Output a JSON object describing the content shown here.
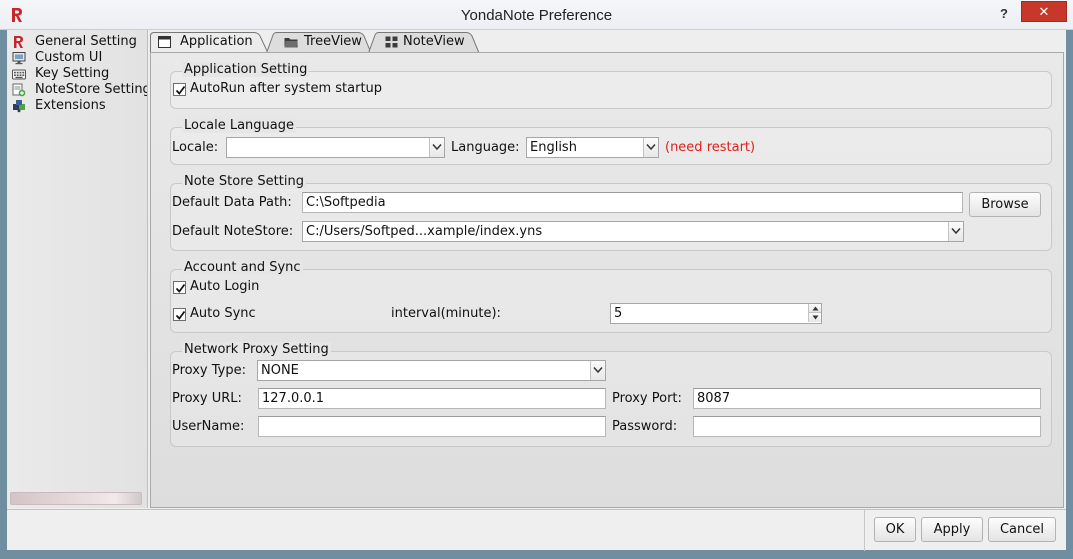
{
  "window": {
    "title": "YondaNote Preference",
    "help": "?",
    "close": "✕"
  },
  "sidebar": {
    "items": [
      {
        "label": "General Setting",
        "icon": "general-setting-icon"
      },
      {
        "label": "Custom UI",
        "icon": "monitor-icon"
      },
      {
        "label": "Key Setting",
        "icon": "keyboard-icon"
      },
      {
        "label": "NoteStore Setting",
        "icon": "notestore-icon"
      },
      {
        "label": "Extensions",
        "icon": "puzzle-icon"
      }
    ]
  },
  "tabs": [
    {
      "label": "Application",
      "icon": "window-icon",
      "active": true
    },
    {
      "label": "TreeView",
      "icon": "folder-icon",
      "active": false
    },
    {
      "label": "NoteView",
      "icon": "grid-icon",
      "active": false
    }
  ],
  "application_setting": {
    "title": "Application Setting",
    "autorun_label": "AutoRun after system startup",
    "autorun_checked": true
  },
  "locale_language": {
    "title": "Locale  Language",
    "locale_label": "Locale:",
    "locale_value": "",
    "language_label": "Language:",
    "language_value": "English",
    "restart_note": "(need restart)",
    "restart_color": "#e0201b"
  },
  "note_store": {
    "title": "Note Store Setting",
    "data_path_label": "Default Data Path:",
    "data_path_value": "C:\\Softpedia",
    "browse_label": "Browse",
    "notestore_label": "Default NoteStore:",
    "notestore_value": "C:/Users/Softped...xample/index.yns"
  },
  "account_sync": {
    "title": "Account and Sync",
    "auto_login_label": "Auto Login",
    "auto_login_checked": true,
    "auto_sync_label": "Auto Sync",
    "auto_sync_checked": true,
    "interval_label": "interval(minute):",
    "interval_value": "5"
  },
  "proxy": {
    "title": "Network Proxy Setting",
    "type_label": "Proxy Type:",
    "type_value": "NONE",
    "url_label": "Proxy URL:",
    "url_value": "127.0.0.1",
    "port_label": "Proxy Port:",
    "port_value": "8087",
    "username_label": "UserName:",
    "username_value": "",
    "password_label": "Password:",
    "password_value": ""
  },
  "footer": {
    "ok_label": "OK",
    "apply_label": "Apply",
    "cancel_label": "Cancel"
  }
}
